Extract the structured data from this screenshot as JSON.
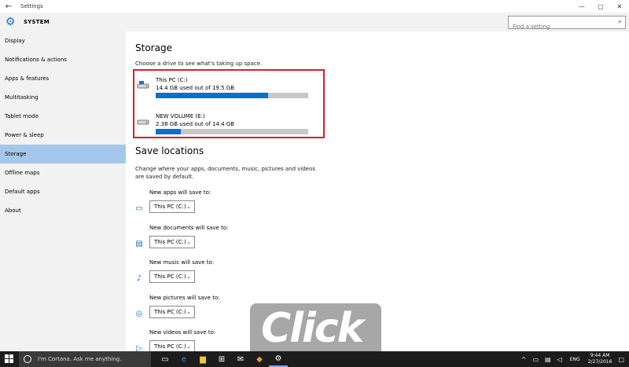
{
  "window": {
    "title": "Settings",
    "back": "←",
    "minimize": "—",
    "maximize": "▢",
    "close": "✕"
  },
  "header": {
    "section": "SYSTEM",
    "search_placeholder": "Find a setting"
  },
  "sidebar": {
    "items": [
      {
        "label": "Display"
      },
      {
        "label": "Notifications & actions"
      },
      {
        "label": "Apps & features"
      },
      {
        "label": "Multitasking"
      },
      {
        "label": "Tablet mode"
      },
      {
        "label": "Power & sleep"
      },
      {
        "label": "Storage"
      },
      {
        "label": "Offline maps"
      },
      {
        "label": "Default apps"
      },
      {
        "label": "About"
      }
    ],
    "active": "Storage"
  },
  "storage": {
    "title": "Storage",
    "hint": "Choose a drive to see what's taking up space.",
    "drives": [
      {
        "name": "This PC (C:)",
        "usage": "14.4 GB used out of 19.5 GB",
        "used_fraction": 0.738
      },
      {
        "name": "NEW VOLUME (E:)",
        "usage": "2.38 GB used out of 14.4 GB",
        "used_fraction": 0.165
      }
    ]
  },
  "save_locations": {
    "title": "Save locations",
    "description": "Change where your apps, documents, music, pictures and videos are saved by default.",
    "items": [
      {
        "label": "New apps will save to:",
        "value": "This PC (C:)",
        "icon": "monitor-icon"
      },
      {
        "label": "New documents will save to:",
        "value": "This PC (C:)",
        "icon": "folder-icon"
      },
      {
        "label": "New music will save to:",
        "value": "This PC (C:)",
        "icon": "music-note-icon"
      },
      {
        "label": "New pictures will save to:",
        "value": "This PC (C:)",
        "icon": "camera-icon"
      },
      {
        "label": "New videos will save to:",
        "value": "This PC (C:)",
        "icon": "video-camera-icon"
      }
    ]
  },
  "watermark": {
    "text": "Click"
  },
  "taskbar": {
    "cortana": "I'm Cortana. Ask me anything.",
    "lang": "ENG",
    "time": "9:44 AM",
    "date": "2/27/2016"
  },
  "colors": {
    "accent": "#0a6fcf",
    "selected": "#a5c7eb",
    "highlight_box": "#d62027"
  }
}
